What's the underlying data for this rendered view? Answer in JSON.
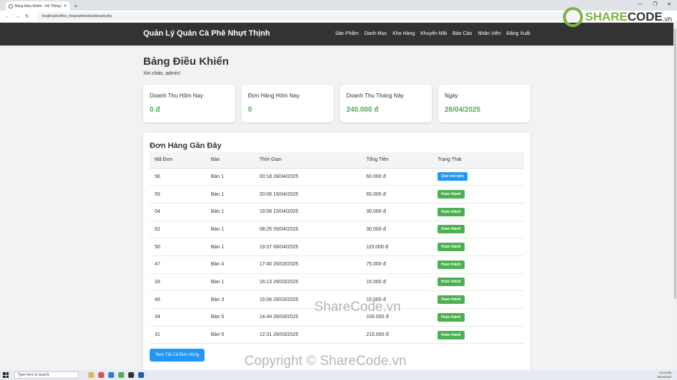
{
  "browser": {
    "tab_title": "Bảng Điều Khiển - Hệ Thống C",
    "url": "localhost/coffee_shop/admin/dashboard.php"
  },
  "header": {
    "brand": "Quản Lý Quán Cà Phê Nhựt Thịnh",
    "nav": [
      "Sản Phẩm",
      "Danh Mục",
      "Kho Hàng",
      "Khuyến Mãi",
      "Báo Cáo",
      "Nhân Viên",
      "Đăng Xuất"
    ]
  },
  "page": {
    "title": "Bảng Điều Khiển",
    "greeting": "Xin chào, admin!"
  },
  "stats": [
    {
      "label": "Doanh Thu Hôm Nay",
      "value": "0 đ"
    },
    {
      "label": "Đơn Hàng Hôm Nay",
      "value": "0"
    },
    {
      "label": "Doanh Thu Tháng Này",
      "value": "240.000 đ"
    },
    {
      "label": "Ngày",
      "value": "28/04/2025"
    }
  ],
  "orders": {
    "title": "Đơn Hàng Gần Đây",
    "columns": [
      "Mã Đơn",
      "Bàn",
      "Thời Gian",
      "Tổng Tiền",
      "Trạng Thái"
    ],
    "rows": [
      [
        "56",
        "Bàn 1",
        "00:18 28/04/2025",
        "60.000 đ",
        "Chờ chế biến"
      ],
      [
        "55",
        "Bàn 1",
        "20:06 15/04/2025",
        "65.000 đ",
        "Hoàn thành"
      ],
      [
        "54",
        "Bàn 1",
        "19:58 15/04/2025",
        "30.000 đ",
        "Hoàn thành"
      ],
      [
        "52",
        "Bàn 1",
        "08:25 09/04/2025",
        "30.000 đ",
        "Hoàn thành"
      ],
      [
        "50",
        "Bàn 1",
        "19:37 06/04/2025",
        "115.000 đ",
        "Hoàn thành"
      ],
      [
        "47",
        "Bàn 4",
        "17:40 26/03/2025",
        "75.000 đ",
        "Hoàn thành"
      ],
      [
        "33",
        "Bàn 1",
        "16:13 26/03/2025",
        "15.000 đ",
        "Hoàn thành"
      ],
      [
        "46",
        "Bàn 3",
        "15:06 26/03/2025",
        "15.000 đ",
        "Hoàn thành"
      ],
      [
        "34",
        "Bàn 5",
        "14:44 26/03/2025",
        "100.000 đ",
        "Hoàn thành"
      ],
      [
        "31",
        "Bàn 5",
        "12:31 26/03/2025",
        "210.000 đ",
        "Hoàn thành"
      ]
    ],
    "view_all_label": "Xem Tất Cả Đơn Hàng"
  },
  "watermark": {
    "logo_brand": "SHARE",
    "logo_brand2": "CODE",
    "logo_tld": ".vn",
    "center": "ShareCode.vn",
    "copyright": "Copyright © ShareCode.vn"
  },
  "taskbar": {
    "search_placeholder": "Type here to search",
    "time": "12:18 AM",
    "date": "28/04/2025"
  },
  "colors": {
    "header_bg": "#333333",
    "stat_value": "#4caf50",
    "status_done": "#4caf50",
    "status_waiting": "#2196f3",
    "button": "#2196f3"
  }
}
